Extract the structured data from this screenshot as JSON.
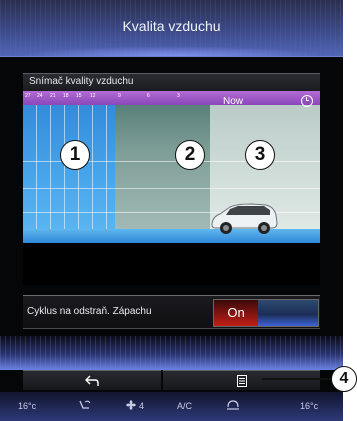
{
  "header": {
    "title": "Kvalita vzduchu"
  },
  "panel": {
    "title": "Snímač kvality vzduchu",
    "timeline_ticks": [
      "27",
      "24",
      "21",
      "18",
      "15",
      "12",
      "9",
      "6",
      "3"
    ],
    "now_label": "Now",
    "zone_markers": [
      "1",
      "2",
      "3"
    ]
  },
  "setting": {
    "label": "Cyklus na odstraň. Zápachu",
    "toggle_on_label": "On"
  },
  "buttons": {
    "back_icon": "back-arrow-icon",
    "menu_icon": "menu-list-icon"
  },
  "status_bar": {
    "temp_left": "16°c",
    "fan_level": "4",
    "ac_label": "A/C",
    "temp_right": "16°c"
  },
  "callout": {
    "label": "4"
  }
}
